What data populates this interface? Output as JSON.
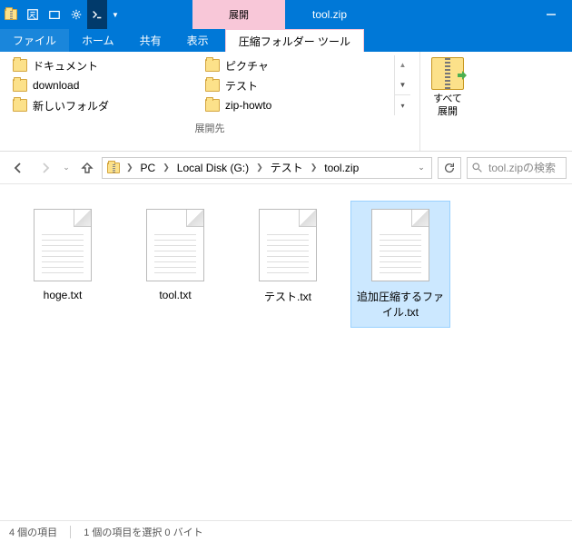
{
  "titlebar": {
    "context_header": "展開",
    "title": "tool.zip"
  },
  "tabs": {
    "file": "ファイル",
    "home": "ホーム",
    "share": "共有",
    "view": "表示",
    "compress_tools": "圧縮フォルダー ツール"
  },
  "ribbon": {
    "dest_col1": [
      "ドキュメント",
      "download",
      "新しいフォルダ"
    ],
    "dest_col2": [
      "ピクチャ",
      "テスト",
      "zip-howto"
    ],
    "group_label": "展開先",
    "extract_all": "すべて\n展開"
  },
  "breadcrumb": [
    "PC",
    "Local Disk (G:)",
    "テスト",
    "tool.zip"
  ],
  "search": {
    "placeholder": "tool.zipの検索"
  },
  "files": [
    {
      "name": "hoge.txt",
      "selected": false
    },
    {
      "name": "tool.txt",
      "selected": false
    },
    {
      "name": "テスト.txt",
      "selected": false
    },
    {
      "name": "追加圧縮するファイル.txt",
      "selected": true
    }
  ],
  "status": {
    "count": "4 個の項目",
    "selection": "1 個の項目を選択 0 バイト"
  }
}
